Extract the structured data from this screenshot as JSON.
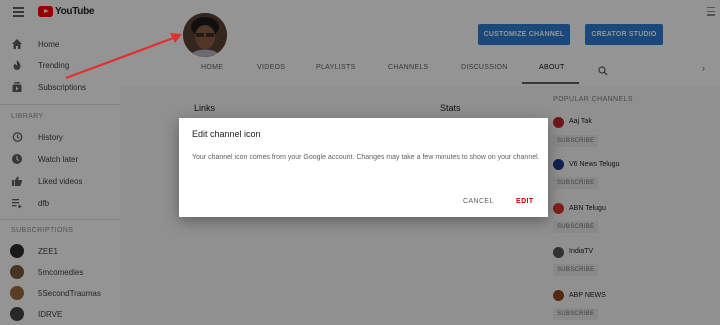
{
  "app": {
    "logo_text": "YouTube"
  },
  "sidebar": {
    "items": [
      {
        "label": "Home",
        "icon": "home-icon"
      },
      {
        "label": "Trending",
        "icon": "fire-icon"
      },
      {
        "label": "Subscriptions",
        "icon": "subscriptions-icon"
      }
    ],
    "library_title": "LIBRARY",
    "library_items": [
      {
        "label": "History",
        "icon": "history-icon"
      },
      {
        "label": "Watch later",
        "icon": "clock-icon"
      },
      {
        "label": "Liked videos",
        "icon": "thumbs-up-icon"
      },
      {
        "label": "dfb",
        "icon": "playlist-icon"
      }
    ],
    "subscriptions_title": "SUBSCRIPTIONS",
    "subscriptions": [
      {
        "label": "ZEE1"
      },
      {
        "label": "5mcomedies"
      },
      {
        "label": "5SecondTraumas"
      },
      {
        "label": "IDRVE"
      }
    ]
  },
  "channel": {
    "customize_label": "CUSTOMIZE CHANNEL",
    "studio_label": "CREATOR STUDIO",
    "tabs": [
      "HOME",
      "VIDEOS",
      "PLAYLISTS",
      "CHANNELS",
      "DISCUSSION",
      "ABOUT"
    ],
    "active_tab": "ABOUT"
  },
  "about": {
    "links_label": "Links",
    "stats_label": "Stats"
  },
  "popular_channels": {
    "title": "POPULAR CHANNELS",
    "subscribe_label": "SUBSCRIBE",
    "channels": [
      {
        "name": "Aaj Tak"
      },
      {
        "name": "V6 News Telugu"
      },
      {
        "name": "ABN Telugu"
      },
      {
        "name": "IndiaTV"
      },
      {
        "name": "ABP NEWS"
      }
    ]
  },
  "dialog": {
    "title": "Edit channel icon",
    "body": "Your channel icon comes from your Google account. Changes may take a few minutes to show on your channel.",
    "cancel_label": "CANCEL",
    "edit_label": "EDIT"
  },
  "colors": {
    "brand_red": "#ff0000",
    "button_blue": "#2d7dd2",
    "edit_red": "#cc0000",
    "arrow_red": "#e03030"
  }
}
